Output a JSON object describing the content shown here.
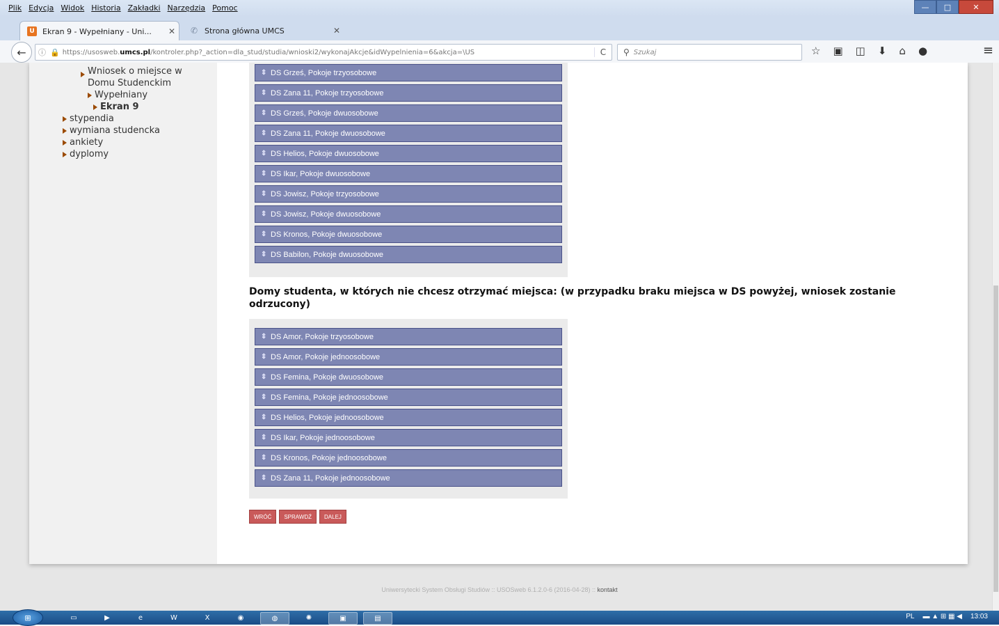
{
  "menu": [
    "Plik",
    "Edycja",
    "Widok",
    "Historia",
    "Zakładki",
    "Narzędzia",
    "Pomoc"
  ],
  "tabs": [
    {
      "label": "Ekran 9 - Wypełniany - Uni...",
      "favicon": "U"
    },
    {
      "label": "Strona główna UMCS",
      "favicon": "✆"
    }
  ],
  "url": {
    "before": "https://usosweb.",
    "domain": "umcs.pl",
    "after": "/kontroler.php?_action=dla_stud/studia/wnioski2/wykonajAkcje&idWypelnienia=6&akcja=\\US"
  },
  "search_placeholder": "Szukaj",
  "sidebar": [
    {
      "label": "Wniosek o miejsce w",
      "indent": 2
    },
    {
      "label": "Domu Studenckim",
      "indent": 2,
      "cont": true
    },
    {
      "label": "Wypełniany",
      "indent": 3
    },
    {
      "label": "Ekran 9",
      "indent": 4,
      "bold": true
    },
    {
      "label": "stypendia",
      "indent": 1
    },
    {
      "label": "wymiana studencka",
      "indent": 1
    },
    {
      "label": "ankiety",
      "indent": 1
    },
    {
      "label": "dyplomy",
      "indent": 1
    }
  ],
  "wanted_list": [
    "DS Grześ, Pokoje trzyosobowe",
    "DS Zana 11, Pokoje trzyosobowe",
    "DS Grześ, Pokoje dwuosobowe",
    "DS Zana 11, Pokoje dwuosobowe",
    "DS Helios, Pokoje dwuosobowe",
    "DS Ikar, Pokoje dwuosobowe",
    "DS Jowisz, Pokoje trzyosobowe",
    "DS Jowisz, Pokoje dwuosobowe",
    "DS Kronos, Pokoje dwuosobowe",
    "DS Babilon, Pokoje dwuosobowe"
  ],
  "heading": "Domy studenta, w których nie chcesz otrzymać miejsca: (w przypadku braku miejsca w DS powyżej, wniosek zostanie odrzucony)",
  "unwanted_list": [
    "DS Amor, Pokoje trzyosobowe",
    "DS Amor, Pokoje jednoosobowe",
    "DS Femina, Pokoje dwuosobowe",
    "DS Femina, Pokoje jednoosobowe",
    "DS Helios, Pokoje jednoosobowe",
    "DS Ikar, Pokoje jednoosobowe",
    "DS Kronos, Pokoje jednoosobowe",
    "DS Zana 11, Pokoje jednoosobowe"
  ],
  "buttons": {
    "back": "WRÓĆ",
    "check": "SPRAWDŹ",
    "next": "DALEJ"
  },
  "footer": {
    "text": "Uniwersytecki System Obsługi Studiów :: USOSweb 6.1.2.0-6 (2016-04-28) :: ",
    "link": "kontakt"
  },
  "taskbar": {
    "lang": "PL",
    "time": "13:03"
  }
}
